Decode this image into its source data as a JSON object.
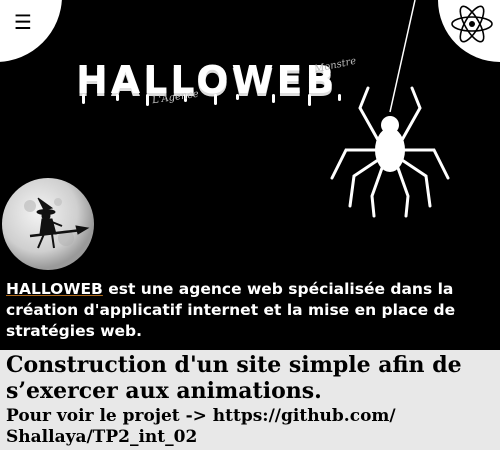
{
  "header": {
    "menu_icon": "hamburger-menu-icon",
    "menu_glyph": "☰",
    "logo_icon": "atom-icon"
  },
  "hero": {
    "title": "HALLOWEB",
    "scribble_left": "L'Agence",
    "scribble_right": "Monstre",
    "spider_icon": "spider-icon",
    "moon_icon": "moon-witch-icon"
  },
  "tagline": {
    "brand": "HALLOWEB",
    "text": " est une agence web spécialisée dans la création d'applicatif internet et la mise en place de stratégies web."
  },
  "info": {
    "heading": "Construction d'un site simple afin de s’exercer aux animations.",
    "link_text": "Pour voir le projet -> https://github.com/ Shallaya/TP2_int_02"
  },
  "colors": {
    "background": "#000000",
    "panel": "#e8e8e8",
    "text_light": "#ffffff"
  }
}
